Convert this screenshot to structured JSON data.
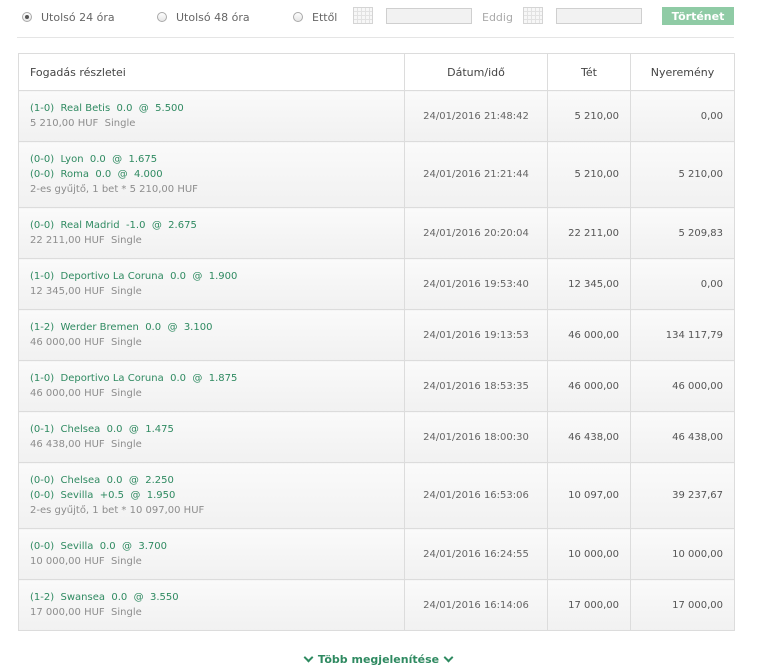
{
  "filters": {
    "last24": "Utolsó 24 óra",
    "last48": "Utolsó 48 óra",
    "from": "Ettől",
    "until": "Eddig",
    "history_button": "Történet",
    "from_value": "",
    "until_value": ""
  },
  "table": {
    "headers": {
      "details": "Fogadás részletei",
      "datetime": "Dátum/idő",
      "stake": "Tét",
      "winnings": "Nyeremény"
    },
    "rows": [
      {
        "bets": [
          {
            "score": "(1-0)",
            "team": "Real Betis",
            "line": "0.0",
            "at": "@",
            "odds": "5.500"
          }
        ],
        "amount": "5 210,00 HUF",
        "type": "Single",
        "date": "24/01/2016 21:48:42",
        "stake": "5 210,00",
        "winnings": "0,00"
      },
      {
        "bets": [
          {
            "score": "(0-0)",
            "team": "Lyon",
            "line": "0.0",
            "at": "@",
            "odds": "1.675"
          },
          {
            "score": "(0-0)",
            "team": "Roma",
            "line": "0.0",
            "at": "@",
            "odds": "4.000"
          }
        ],
        "amount": "2-es gyűjtő, 1  bet * 5 210,00 HUF",
        "type": "",
        "date": "24/01/2016 21:21:44",
        "stake": "5 210,00",
        "winnings": "5 210,00"
      },
      {
        "bets": [
          {
            "score": "(0-0)",
            "team": "Real Madrid",
            "line": "-1.0",
            "at": "@",
            "odds": "2.675"
          }
        ],
        "amount": "22 211,00 HUF",
        "type": "Single",
        "date": "24/01/2016 20:20:04",
        "stake": "22 211,00",
        "winnings": "5 209,83"
      },
      {
        "bets": [
          {
            "score": "(1-0)",
            "team": "Deportivo La Coruna",
            "line": "0.0",
            "at": "@",
            "odds": "1.900"
          }
        ],
        "amount": "12 345,00 HUF",
        "type": "Single",
        "date": "24/01/2016 19:53:40",
        "stake": "12 345,00",
        "winnings": "0,00"
      },
      {
        "bets": [
          {
            "score": "(1-2)",
            "team": "Werder Bremen",
            "line": "0.0",
            "at": "@",
            "odds": "3.100"
          }
        ],
        "amount": "46 000,00 HUF",
        "type": "Single",
        "date": "24/01/2016 19:13:53",
        "stake": "46 000,00",
        "winnings": "134 117,79"
      },
      {
        "bets": [
          {
            "score": "(1-0)",
            "team": "Deportivo La Coruna",
            "line": "0.0",
            "at": "@",
            "odds": "1.875"
          }
        ],
        "amount": "46 000,00 HUF",
        "type": "Single",
        "date": "24/01/2016 18:53:35",
        "stake": "46 000,00",
        "winnings": "46 000,00"
      },
      {
        "bets": [
          {
            "score": "(0-1)",
            "team": "Chelsea",
            "line": "0.0",
            "at": "@",
            "odds": "1.475"
          }
        ],
        "amount": "46 438,00 HUF",
        "type": "Single",
        "date": "24/01/2016 18:00:30",
        "stake": "46 438,00",
        "winnings": "46 438,00"
      },
      {
        "bets": [
          {
            "score": "(0-0)",
            "team": "Chelsea",
            "line": "0.0",
            "at": "@",
            "odds": "2.250"
          },
          {
            "score": "(0-0)",
            "team": "Sevilla",
            "line": "+0.5",
            "at": "@",
            "odds": "1.950"
          }
        ],
        "amount": "2-es gyűjtő, 1  bet * 10 097,00 HUF",
        "type": "",
        "date": "24/01/2016 16:53:06",
        "stake": "10 097,00",
        "winnings": "39 237,67"
      },
      {
        "bets": [
          {
            "score": "(0-0)",
            "team": "Sevilla",
            "line": "0.0",
            "at": "@",
            "odds": "3.700"
          }
        ],
        "amount": "10 000,00 HUF",
        "type": "Single",
        "date": "24/01/2016 16:24:55",
        "stake": "10 000,00",
        "winnings": "10 000,00"
      },
      {
        "bets": [
          {
            "score": "(1-2)",
            "team": "Swansea",
            "line": "0.0",
            "at": "@",
            "odds": "3.550"
          }
        ],
        "amount": "17 000,00 HUF",
        "type": "Single",
        "date": "24/01/2016 16:14:06",
        "stake": "17 000,00",
        "winnings": "17 000,00"
      }
    ]
  },
  "more_label": "Több megjelenítése",
  "colors": {
    "accent_green": "#2f8a61",
    "button_green": "#8fcba5"
  }
}
